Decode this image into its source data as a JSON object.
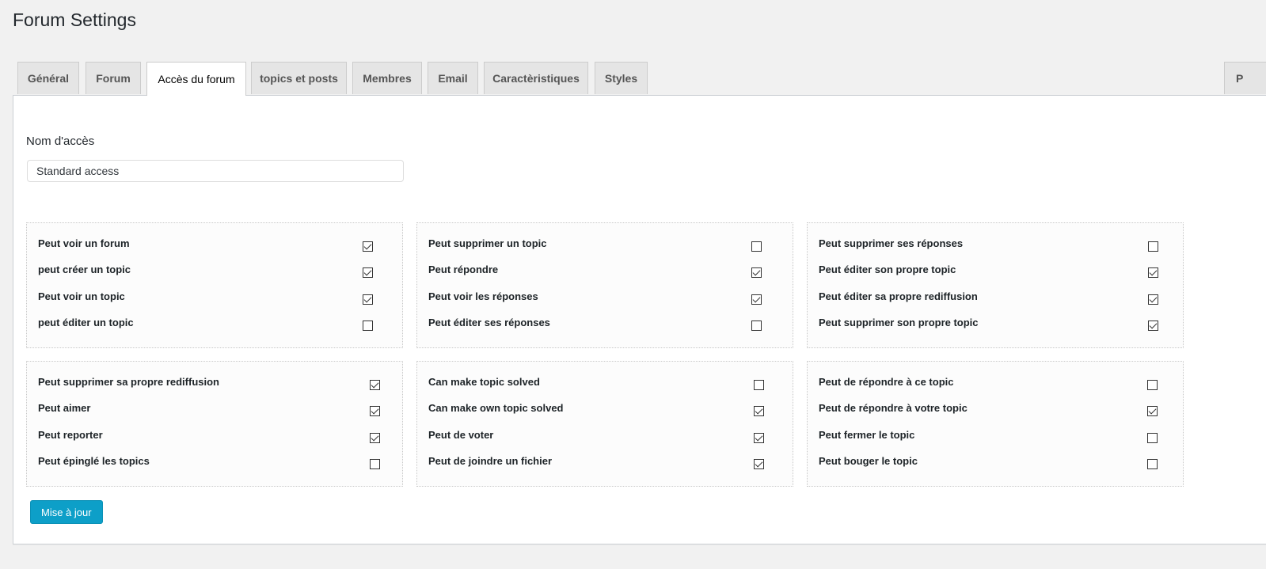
{
  "page": {
    "title": "Forum Settings"
  },
  "tabs": [
    {
      "label": "Général",
      "active": false
    },
    {
      "label": "Forum",
      "active": false
    },
    {
      "label": "Accès du forum",
      "active": true
    },
    {
      "label": "topics et posts",
      "active": false
    },
    {
      "label": "Membres",
      "active": false
    },
    {
      "label": "Email",
      "active": false
    },
    {
      "label": "Caractèristiques",
      "active": false
    },
    {
      "label": "Styles",
      "active": false
    },
    {
      "label": "P",
      "active": false
    }
  ],
  "access_form": {
    "name_label": "Nom d'accès",
    "name_value": "Standard access"
  },
  "groups": [
    {
      "items": [
        {
          "label": "Peut voir un forum",
          "checked": true
        },
        {
          "label": "peut créer un topic",
          "checked": true
        },
        {
          "label": "Peut voir un topic",
          "checked": true
        },
        {
          "label": "peut éditer un topic",
          "checked": false
        }
      ]
    },
    {
      "items": [
        {
          "label": "Peut supprimer un topic",
          "checked": false
        },
        {
          "label": "Peut répondre",
          "checked": true
        },
        {
          "label": "Peut voir les réponses",
          "checked": true
        },
        {
          "label": "Peut éditer ses réponses",
          "checked": false
        }
      ]
    },
    {
      "items": [
        {
          "label": "Peut supprimer ses réponses",
          "checked": false
        },
        {
          "label": "Peut éditer son propre topic",
          "checked": true
        },
        {
          "label": "Peut éditer sa propre rediffusion",
          "checked": true
        },
        {
          "label": "Peut supprimer son propre topic",
          "checked": true
        }
      ]
    },
    {
      "items": [
        {
          "label": "Peut supprimer sa propre rediffusion",
          "checked": true
        },
        {
          "label": "Peut aimer",
          "checked": true
        },
        {
          "label": "Peut reporter",
          "checked": true
        },
        {
          "label": "Peut épinglé les topics",
          "checked": false
        }
      ]
    },
    {
      "items": [
        {
          "label": "Can make topic solved",
          "checked": false
        },
        {
          "label": "Can make own topic solved",
          "checked": true
        },
        {
          "label": "Peut de voter",
          "checked": true
        },
        {
          "label": "Peut de joindre un fichier",
          "checked": true
        }
      ]
    },
    {
      "items": [
        {
          "label": "Peut de répondre à ce topic",
          "checked": false
        },
        {
          "label": "Peut de répondre à votre topic",
          "checked": true
        },
        {
          "label": "Peut fermer le topic",
          "checked": false
        },
        {
          "label": "Peut bouger le topic",
          "checked": false
        }
      ]
    }
  ],
  "actions": {
    "update_label": "Mise à jour"
  }
}
